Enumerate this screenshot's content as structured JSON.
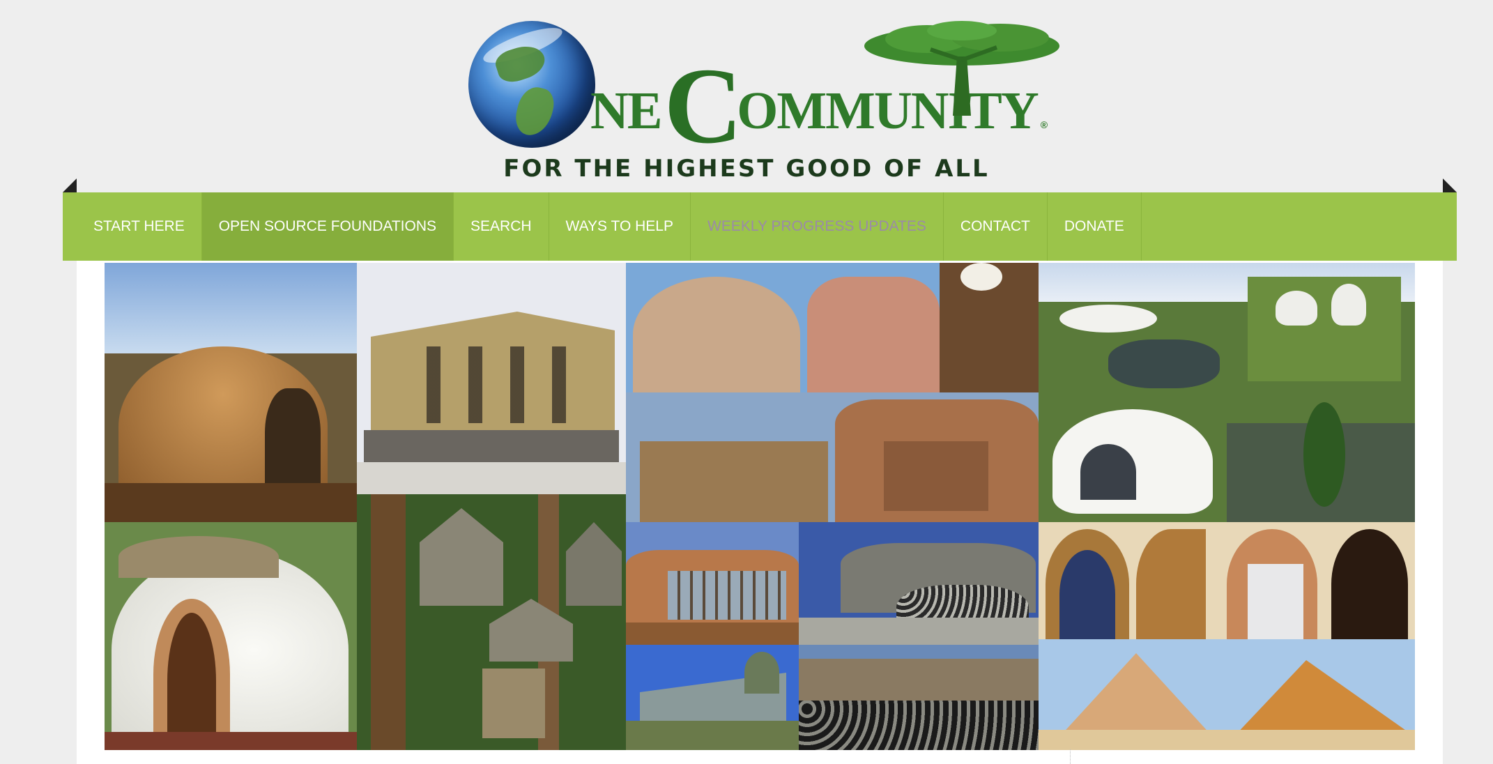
{
  "header": {
    "logo_word_part1": "NE",
    "logo_big_c": "C",
    "logo_word_part2": "OMMUNITY",
    "logo_registered": "®",
    "tagline": "FOR THE HIGHEST GOOD OF ALL"
  },
  "nav": {
    "items": [
      {
        "label": "START HERE"
      },
      {
        "label": "OPEN SOURCE FOUNDATIONS"
      },
      {
        "label": "SEARCH"
      },
      {
        "label": "WAYS TO HELP"
      },
      {
        "label": "WEEKLY PROGRESS UPDATES"
      },
      {
        "label": "CONTACT"
      },
      {
        "label": "DONATE"
      }
    ],
    "active_index": 1
  },
  "colors": {
    "nav_bg": "#9bc44a",
    "nav_active": "#86ae3c",
    "page_bg": "#eeeeee",
    "logo_green": "#2f7a2a",
    "tagline": "#1c3a1c"
  },
  "collage": {
    "photos": [
      "earthbag-dome-construction",
      "straw-bale-three-story-building",
      "cob-and-adobe-houses",
      "organic-white-earth-shelters",
      "cob-cottage-white-dome",
      "treehouse-village",
      "earthship-tire-walls",
      "pyramid-structures"
    ]
  }
}
